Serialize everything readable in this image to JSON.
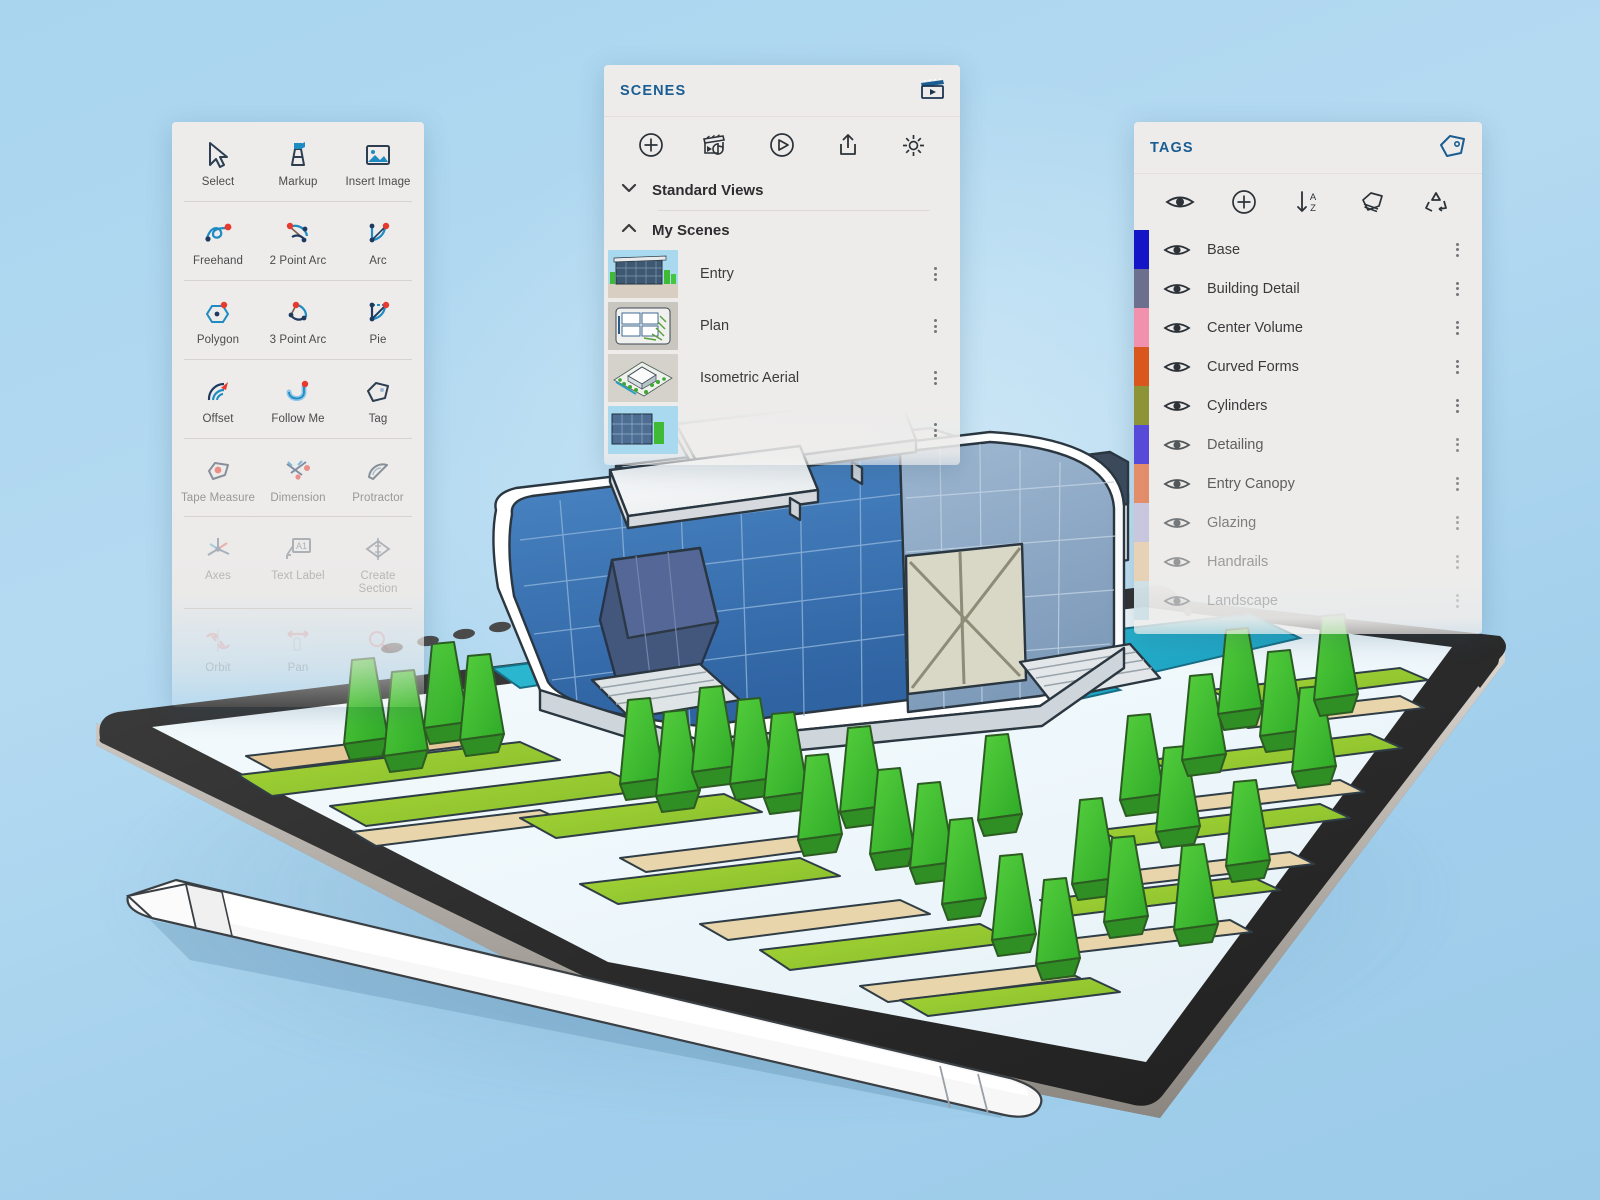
{
  "app": {
    "device": "tablet",
    "accent_color": "#1a5d92",
    "panel_bg": "#edeceb",
    "background_colors": [
      "#a9d5ef",
      "#b4daf1",
      "#9bcbe9"
    ]
  },
  "tools_panel": {
    "name": "Tools",
    "groups": [
      {
        "tools": [
          {
            "label": "Select",
            "icon": "cursor-arrow-icon",
            "state": "active"
          },
          {
            "label": "Markup",
            "icon": "marker-pen-icon",
            "state": "active"
          },
          {
            "label": "Insert Image",
            "icon": "insert-image-icon",
            "state": "active"
          }
        ]
      },
      {
        "tools": [
          {
            "label": "Freehand",
            "icon": "freehand-icon",
            "state": "active"
          },
          {
            "label": "2 Point Arc",
            "icon": "two-point-arc-icon",
            "state": "active"
          },
          {
            "label": "Arc",
            "icon": "arc-icon",
            "state": "active"
          }
        ]
      },
      {
        "tools": [
          {
            "label": "Polygon",
            "icon": "polygon-icon",
            "state": "active"
          },
          {
            "label": "3 Point Arc",
            "icon": "three-point-arc-icon",
            "state": "active"
          },
          {
            "label": "Pie",
            "icon": "pie-icon",
            "state": "active"
          }
        ]
      },
      {
        "tools": [
          {
            "label": "Offset",
            "icon": "offset-icon",
            "state": "active"
          },
          {
            "label": "Follow Me",
            "icon": "follow-me-icon",
            "state": "active"
          },
          {
            "label": "Tag",
            "icon": "tag-icon",
            "state": "active"
          }
        ]
      },
      {
        "tools": [
          {
            "label": "Tape Measure",
            "icon": "tape-measure-icon",
            "state": "faded"
          },
          {
            "label": "Dimension",
            "icon": "dimension-icon",
            "state": "faded"
          },
          {
            "label": "Protractor",
            "icon": "protractor-icon",
            "state": "faded"
          }
        ]
      },
      {
        "tools": [
          {
            "label": "Axes",
            "icon": "axes-icon",
            "state": "faded2"
          },
          {
            "label": "Text Label",
            "icon": "text-label-icon",
            "state": "faded2"
          },
          {
            "label": "Create Section",
            "icon": "create-section-icon",
            "state": "faded2"
          }
        ]
      },
      {
        "tools": [
          {
            "label": "Orbit",
            "icon": "orbit-icon",
            "state": "faded3"
          },
          {
            "label": "Pan",
            "icon": "pan-icon",
            "state": "faded3"
          },
          {
            "label": "",
            "icon": "zoom-icon",
            "state": "faded3"
          }
        ]
      }
    ]
  },
  "scenes_panel": {
    "title": "SCENES",
    "header_icon": "scene-clapperboard-icon",
    "toolbar": [
      {
        "name": "add-scene-button",
        "icon": "plus-circle-icon"
      },
      {
        "name": "update-scene-button",
        "icon": "clapperboard-refresh-icon"
      },
      {
        "name": "play-animation-button",
        "icon": "play-circle-icon"
      },
      {
        "name": "export-animation-button",
        "icon": "share-export-icon"
      },
      {
        "name": "scene-settings-button",
        "icon": "gear-icon"
      }
    ],
    "sections": [
      {
        "label": "Standard Views",
        "expanded": false,
        "chevron": "chevron-down-icon"
      },
      {
        "label": "My Scenes",
        "expanded": true,
        "chevron": "chevron-up-icon"
      }
    ],
    "scenes": [
      {
        "name": "Entry",
        "thumbnail": "entry-elevation-thumbnail"
      },
      {
        "name": "Plan",
        "thumbnail": "site-plan-thumbnail"
      },
      {
        "name": "Isometric Aerial",
        "thumbnail": "isometric-aerial-thumbnail"
      },
      {
        "name": "",
        "thumbnail": "fourth-scene-thumbnail"
      }
    ]
  },
  "tags_panel": {
    "title": "TAGS",
    "header_icon": "tag-outline-icon",
    "toolbar": [
      {
        "name": "toggle-all-visibility-button",
        "icon": "eye-icon"
      },
      {
        "name": "add-tag-button",
        "icon": "plus-circle-icon"
      },
      {
        "name": "sort-az-button",
        "icon": "sort-a-z-icon"
      },
      {
        "name": "tag-folder-button",
        "icon": "tag-stack-icon"
      },
      {
        "name": "purge-tags-button",
        "icon": "recycle-icon"
      }
    ],
    "tags": [
      {
        "name": "Base",
        "color": "#1515c8",
        "visible": true,
        "fade": ""
      },
      {
        "name": "Building Detail",
        "color": "#6d6f8e",
        "visible": true,
        "fade": ""
      },
      {
        "name": "Center Volume",
        "color": "#f291ad",
        "visible": true,
        "fade": ""
      },
      {
        "name": "Curved Forms",
        "color": "#d9561f",
        "visible": true,
        "fade": ""
      },
      {
        "name": "Cylinders",
        "color": "#8d9437",
        "visible": true,
        "fade": ""
      },
      {
        "name": "Detailing",
        "color": "#3222d4",
        "visible": true,
        "fade": "f1"
      },
      {
        "name": "Entry Canopy",
        "color": "#e0764a",
        "visible": true,
        "fade": "f1"
      },
      {
        "name": "Glazing",
        "color": "#b3b0d6",
        "visible": true,
        "fade": "f2"
      },
      {
        "name": "Handrails",
        "color": "#e0b477",
        "visible": true,
        "fade": "f3"
      },
      {
        "name": "Landscape",
        "color": "#8fc7dc",
        "visible": true,
        "fade": "f4"
      }
    ]
  },
  "canvas": {
    "model_name": "architectural-building-model",
    "description_elements": [
      "curved-white-roof-building",
      "blue-glass-curtain-wall",
      "entry-canopy",
      "reflecting-pool",
      "stairs",
      "tree-rows",
      "lawn-strips",
      "wooden-benches"
    ]
  },
  "stylus": {
    "name": "stylus-pen",
    "color": "#f2f2f2"
  }
}
